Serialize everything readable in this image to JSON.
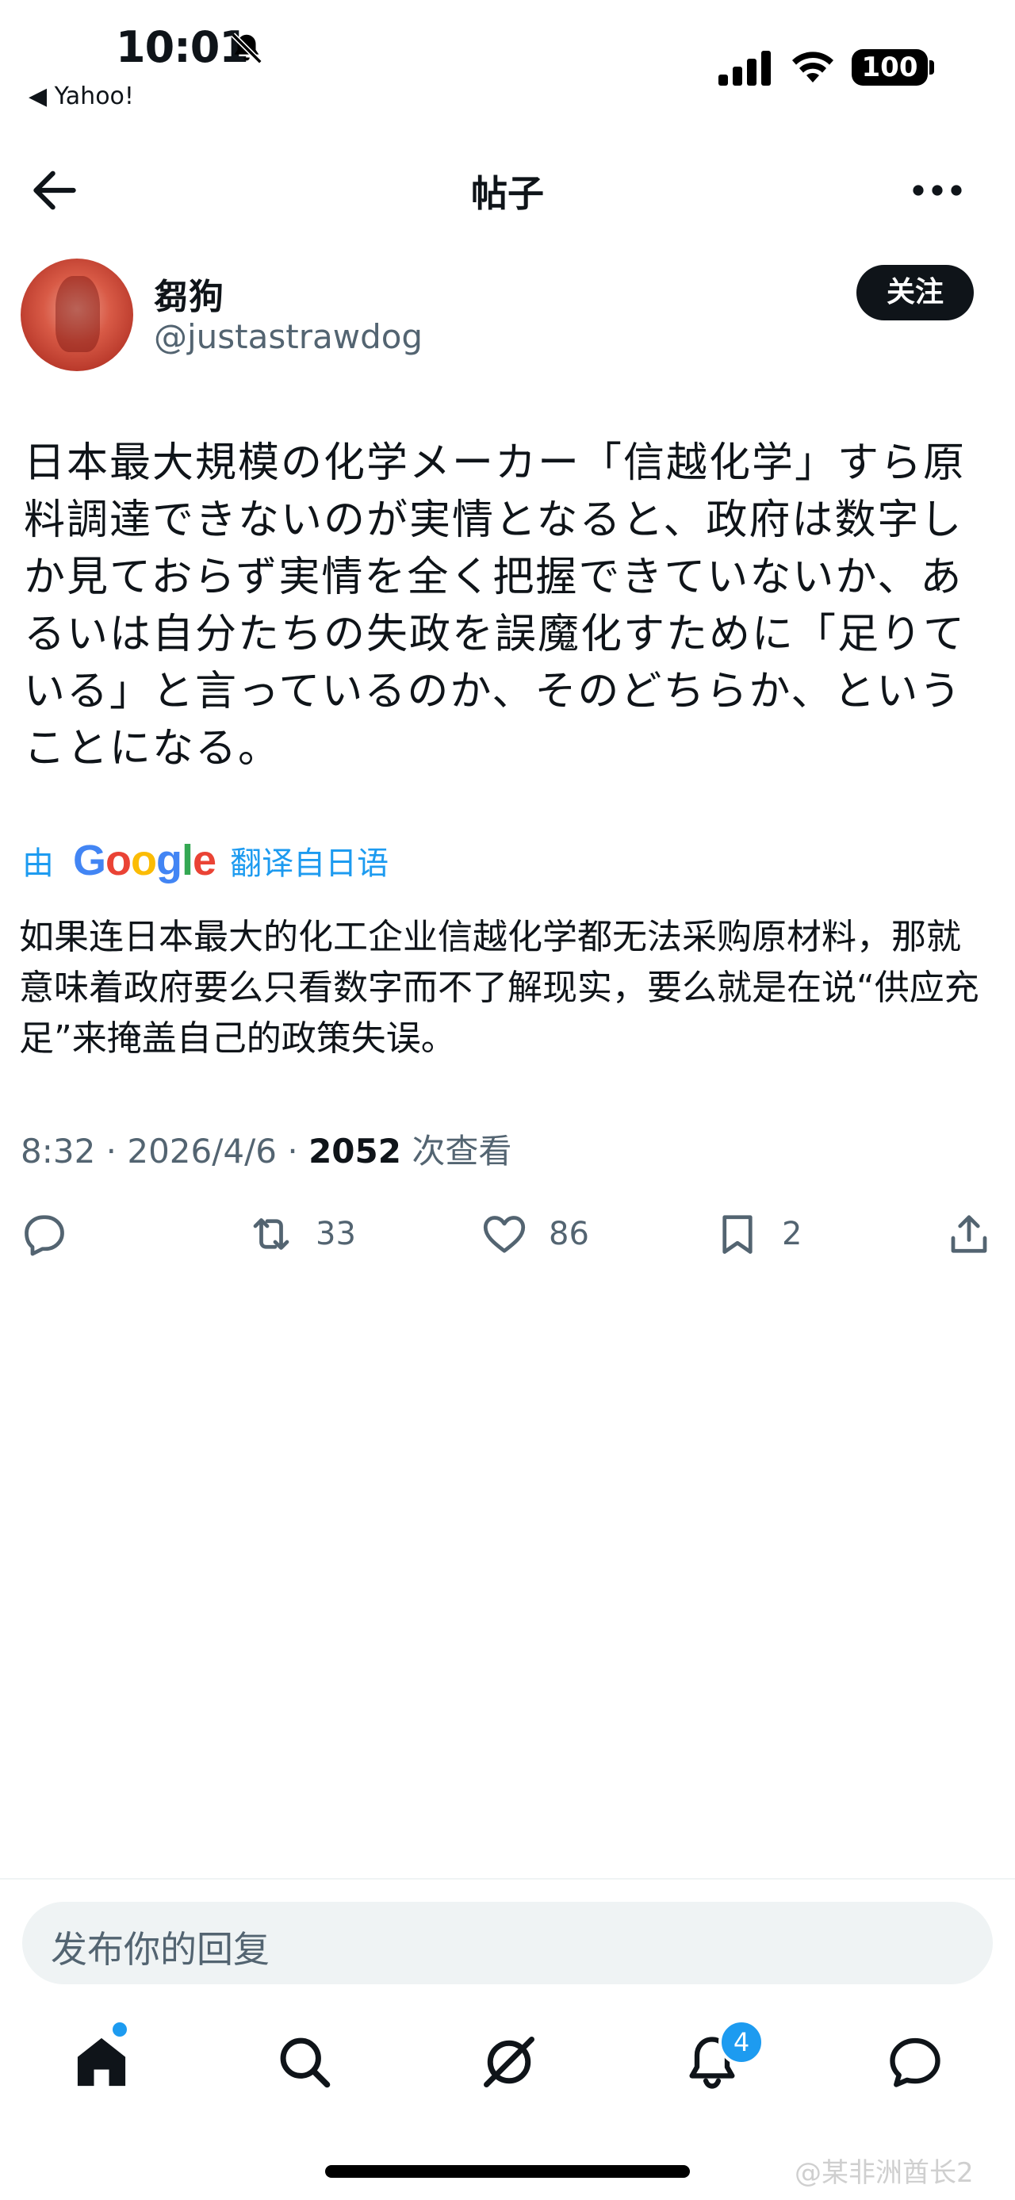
{
  "status_bar": {
    "time": "10:01",
    "back_app": "◀ Yahoo!",
    "battery": "100"
  },
  "header": {
    "title": "帖子"
  },
  "author": {
    "display_name": "芻狗",
    "handle": "@justastrawdog",
    "follow_label": "关注"
  },
  "post": {
    "text": "日本最大規模の化学メーカー「信越化学」すら原料調達できないのが実情となると、政府は数字しか見ておらず実情を全く把握できていないか、あるいは自分たちの失政を誤魔化すために「足りている」と言っているのか、そのどちらか、ということになる。",
    "translate_prefix": "由",
    "translate_brand": "Google",
    "translate_suffix": "翻译自日语",
    "translated_text": "如果连日本最大的化工企业信越化学都无法采购原材料，那就意味着政府要么只看数字而不了解现实，要么就是在说“供应充足”来掩盖自己的政策失误。",
    "time": "8:32 · 2026/4/6 · ",
    "views_count": "2052",
    "views_label": " 次查看"
  },
  "actions": {
    "retweets": "33",
    "likes": "86",
    "bookmarks": "2"
  },
  "reply": {
    "placeholder": "发布你的回复"
  },
  "tabbar": {
    "notifications_badge": "4"
  },
  "watermark": "@某非洲酋长2",
  "icons": [
    "bell-slash-icon",
    "signal-icon",
    "wifi-icon",
    "back-arrow-icon",
    "more-icon",
    "reply-icon",
    "retweet-icon",
    "like-icon",
    "bookmark-icon",
    "share-icon",
    "home-icon",
    "search-icon",
    "grok-icon",
    "notifications-icon",
    "messages-icon"
  ],
  "colors": {
    "accent": "#1d9bf0",
    "text": "#0f1419",
    "secondary": "#536471"
  }
}
